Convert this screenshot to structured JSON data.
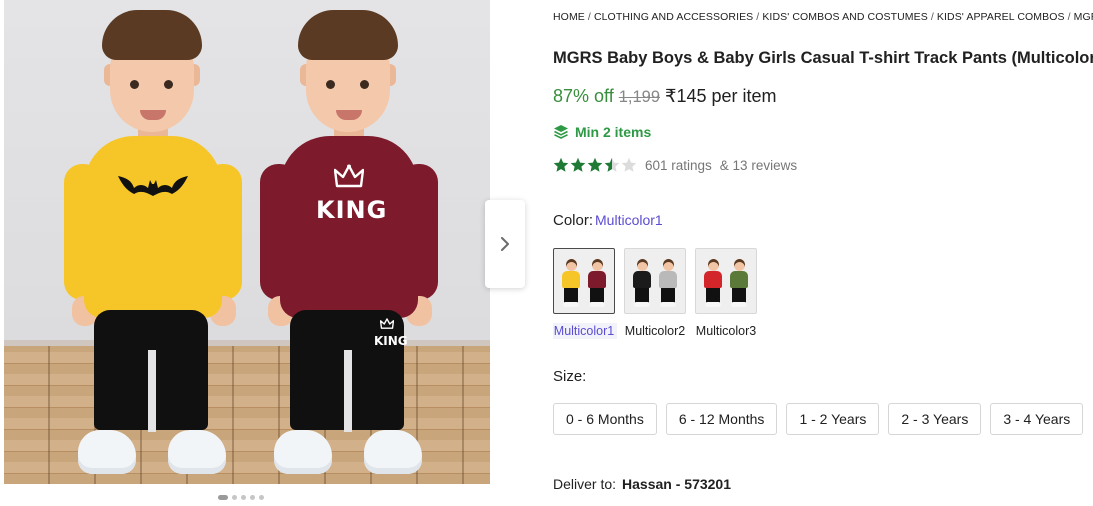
{
  "breadcrumb": [
    "HOME",
    "CLOTHING AND ACCESSORIES",
    "KIDS' COMBOS AND COSTUMES",
    "KIDS' APPAREL COMBOS",
    "MGRS KIDS"
  ],
  "product": {
    "title": "MGRS Baby Boys & Baby Girls Casual T-shirt Track Pants (Multicolor)",
    "discount": "87% off",
    "mrp": "1,199",
    "price": "₹145 per item",
    "min_qty": "Min 2 items",
    "rating_value": 3.5,
    "ratings_text": "601 ratings",
    "reviews_text": "& 13 reviews"
  },
  "gallery": {
    "shirt_print": "KING",
    "pants_print": "KING",
    "dots_total": 5,
    "dot_active": 0
  },
  "color": {
    "label": "Color:",
    "selected": "Multicolor1",
    "swatches": [
      {
        "label": "Multicolor1",
        "tops": [
          "#f6c628",
          "#7d1a2b"
        ]
      },
      {
        "label": "Multicolor2",
        "tops": [
          "#1b1b1b",
          "#b9b9b9"
        ]
      },
      {
        "label": "Multicolor3",
        "tops": [
          "#d3262b",
          "#5b7a3a"
        ]
      }
    ]
  },
  "size": {
    "label": "Size:",
    "options": [
      "0 - 6 Months",
      "6 - 12 Months",
      "1 - 2 Years",
      "2 - 3 Years",
      "3 - 4 Years"
    ]
  },
  "delivery": {
    "label": "Deliver to:",
    "location": "Hassan - 573201"
  },
  "colors": {
    "discount_green": "#388e3c",
    "min_qty_green": "#2e9a45",
    "star_green": "#1e7a34",
    "accent_purple": "#5b4cd1"
  },
  "icons": {
    "min_qty": "layers-icon",
    "next": "chevron-right-icon",
    "star": "star-icon"
  }
}
